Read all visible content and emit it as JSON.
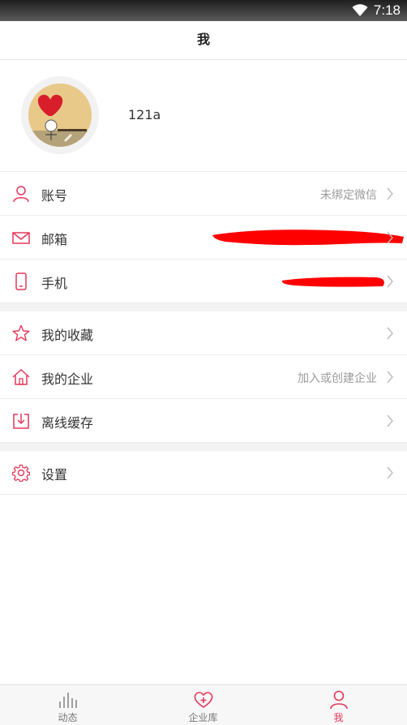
{
  "status_bar": {
    "time": "7:18",
    "wifi_icon": "wifi-icon"
  },
  "header": {
    "title": "我"
  },
  "profile": {
    "username": "121a",
    "avatar_icon": "avatar-image"
  },
  "accent_color": "#e5375a",
  "account_section": [
    {
      "label": "账号",
      "value": "未绑定微信",
      "icon": "person-icon"
    },
    {
      "label": "邮箱",
      "value": "",
      "icon": "mail-icon"
    },
    {
      "label": "手机",
      "value": "",
      "icon": "phone-icon"
    }
  ],
  "menu_section": [
    {
      "label": "我的收藏",
      "value": "",
      "icon": "star-icon"
    },
    {
      "label": "我的企业",
      "value": "加入或创建企业",
      "icon": "home-icon"
    },
    {
      "label": "离线缓存",
      "value": "",
      "icon": "download-icon"
    }
  ],
  "settings_section": [
    {
      "label": "设置",
      "value": "",
      "icon": "gear-icon"
    }
  ],
  "tabbar": {
    "active": "我",
    "tabs": [
      {
        "label": "动态",
        "icon": "bar-chart-icon"
      },
      {
        "label": "企业库",
        "icon": "heart-plus-icon"
      },
      {
        "label": "我",
        "icon": "person-icon"
      }
    ]
  }
}
